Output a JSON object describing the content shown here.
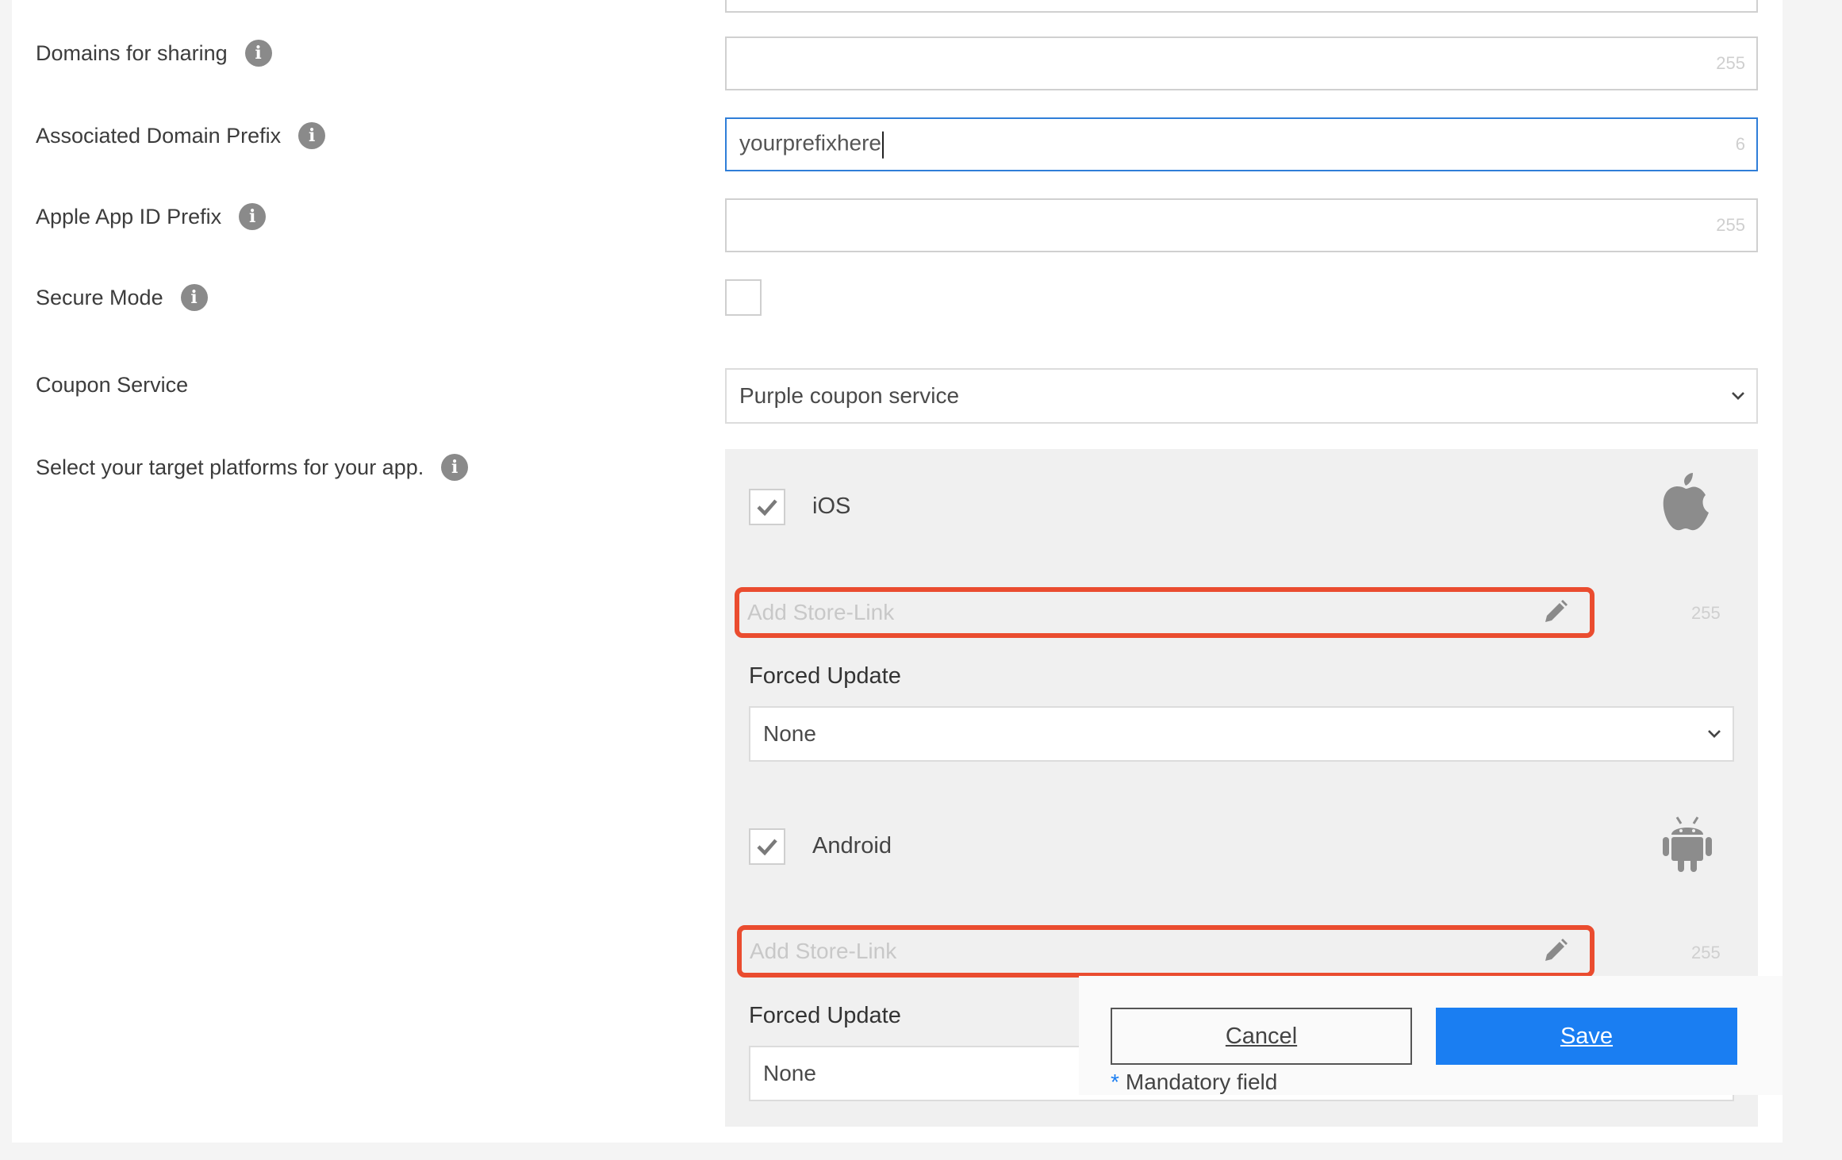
{
  "form": {
    "domains_for_sharing": {
      "label": "Domains for sharing",
      "value": "",
      "counter": "255"
    },
    "associated_domain_prefix": {
      "label": "Associated Domain Prefix",
      "value": "yourprefixhere",
      "counter": "6"
    },
    "apple_app_id_prefix": {
      "label": "Apple App ID Prefix",
      "value": "",
      "counter": "255"
    },
    "secure_mode": {
      "label": "Secure Mode",
      "checked": false
    },
    "coupon_service": {
      "label": "Coupon Service",
      "selected": "Purple coupon service"
    },
    "target_platforms": {
      "label": "Select your target platforms for your app."
    }
  },
  "platforms": {
    "ios": {
      "label": "iOS",
      "checked": true,
      "icon": "apple-icon",
      "store_link_placeholder": "Add Store-Link",
      "counter": "255",
      "forced_update_label": "Forced Update",
      "forced_update_value": "None"
    },
    "android": {
      "label": "Android",
      "checked": true,
      "icon": "android-icon",
      "store_link_placeholder": "Add Store-Link",
      "counter": "255",
      "forced_update_label": "Forced Update",
      "forced_update_value": "None"
    }
  },
  "footer": {
    "cancel_label": "Cancel",
    "save_label": "Save",
    "mandatory_star": "*",
    "mandatory_text": "Mandatory field"
  },
  "colors": {
    "highlight": "#ea4c2f",
    "accent": "#1a7ef2",
    "focus": "#2f7ed8"
  }
}
